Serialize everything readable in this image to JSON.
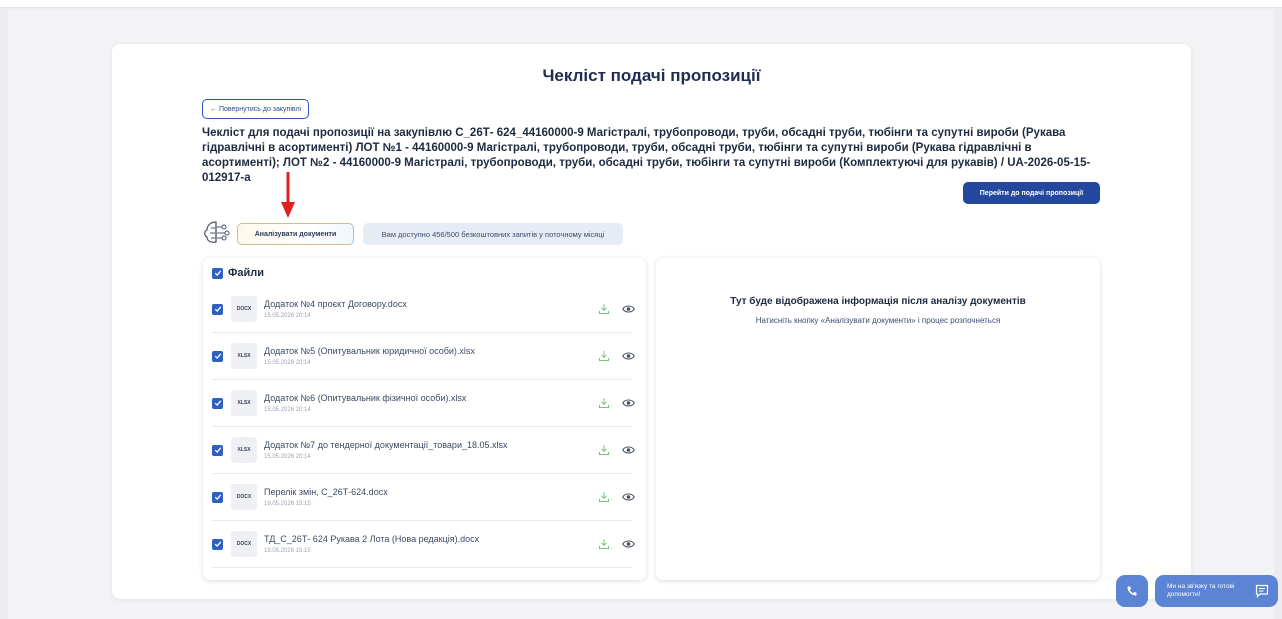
{
  "page": {
    "title": "Чекліст подачі пропозиції",
    "back_label": "← Повернутись до закупівлі",
    "heading": "Чекліст для подачі пропозиції на закупівлю С_26Т- 624_44160000-9 Магістралі, трубопроводи, труби, обсадні труби, тюбінги та супутні вироби (Рукава гідравлічні в асортименті) ЛОТ №1 - 44160000-9 Магістралі, трубопроводи, труби, обсадні труби, тюбінги та супутні вироби (Рукава гідравлічні в асортименті); ЛОТ №2 - 44160000-9 Магістралі, трубопроводи, труби, обсадні труби, тюбінги та супутні вироби (Комплектуючі для рукавів) / UA-2026-05-15-012917-a",
    "submit_label": "Перейти до подачі пропозиції"
  },
  "toolbar": {
    "analyze_label": "Аналізувати документи",
    "quota_text": "Вам доступно 456/500 безкоштовних запитів у поточному місяці"
  },
  "files": {
    "title": "Файли",
    "items": [
      {
        "ext": "DOCX",
        "name": "Додаток №4 проєкт Договору.docx",
        "date": "15.05.2026 20:14"
      },
      {
        "ext": "XLSX",
        "name": "Додаток №5 (Опитувальник юридичної особи).xlsx",
        "date": "15.05.2026 20:14"
      },
      {
        "ext": "XLSX",
        "name": "Додаток №6 (Опитувальник фізичної особи).xlsx",
        "date": "15.05.2026 20:14"
      },
      {
        "ext": "XLSX",
        "name": "Додаток №7 до тендерної документації_товари_18.05.xlsx",
        "date": "15.05.2026 20:14"
      },
      {
        "ext": "DOCX",
        "name": "Перелік змін, С_26Т-624.docx",
        "date": "19.05.2026 15:15"
      },
      {
        "ext": "DOCX",
        "name": "ТД_С_26Т- 624 Рукава 2 Лота (Нова редакція).docx",
        "date": "19.05.2026 15:15"
      }
    ]
  },
  "info": {
    "title": "Тут буде відображена інформація після аналізу документів",
    "subtitle": "Натисніть кнопку «Аналізувати документи» і процес розпочнеться"
  },
  "support": {
    "chat_text": "Ми на зв'язку та готові допомогти!"
  },
  "colors": {
    "primary": "#24489e",
    "checkbox": "#2e60bf",
    "support": "#5b84d4",
    "arrow": "#e02020"
  }
}
